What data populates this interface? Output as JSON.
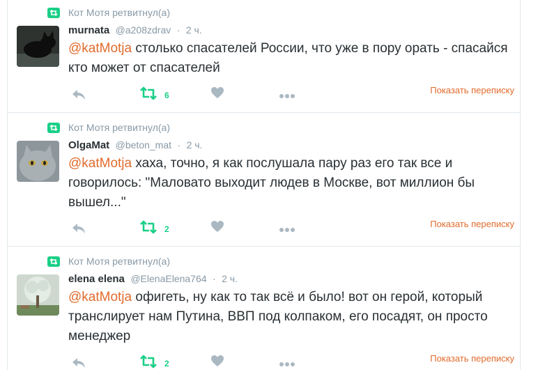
{
  "colors": {
    "accent": "#e06b2c",
    "retweet_green": "#19cf86",
    "muted": "#8899a6",
    "text": "#292f33",
    "icon_gray": "#aab8c2"
  },
  "icons": {
    "retweet": "retweet-icon",
    "reply": "reply-icon",
    "like": "heart-icon",
    "more": "more-icon"
  },
  "tweets": [
    {
      "retweeted_by": "Кот Мотя ретвитнул(а)",
      "name": "murnata",
      "handle": "@a208zdrav",
      "dot": "·",
      "time": "2 ч.",
      "mention": "@katMotja",
      "text": "столько спасателей России, что уже в пору орать - спасайся кто может от спасателей",
      "retweet_count": "6",
      "show_conversation": "Показать переписку"
    },
    {
      "retweeted_by": "Кот Мотя ретвитнул(а)",
      "name": "OlgaMat",
      "handle": "@beton_mat",
      "dot": "·",
      "time": "2 ч.",
      "mention": "@katMotja",
      "text": "хаха, точно, я как послушала пару раз его так все и говорилось: \"Маловато выходит людев в Москве, вот миллион бы вышел...\"",
      "retweet_count": "2",
      "show_conversation": "Показать переписку"
    },
    {
      "retweeted_by": "Кот Мотя ретвитнул(а)",
      "name": "elena elena",
      "handle": "@ElenaElena764",
      "dot": "·",
      "time": "2 ч.",
      "mention": "@katMotja",
      "text": "офигеть, ну как то так всё и было! вот он герой, который транслирует нам Путина, ВВП под колпаком, его посадят, он просто менеджер",
      "retweet_count": "2",
      "show_conversation": "Показать переписку"
    }
  ]
}
